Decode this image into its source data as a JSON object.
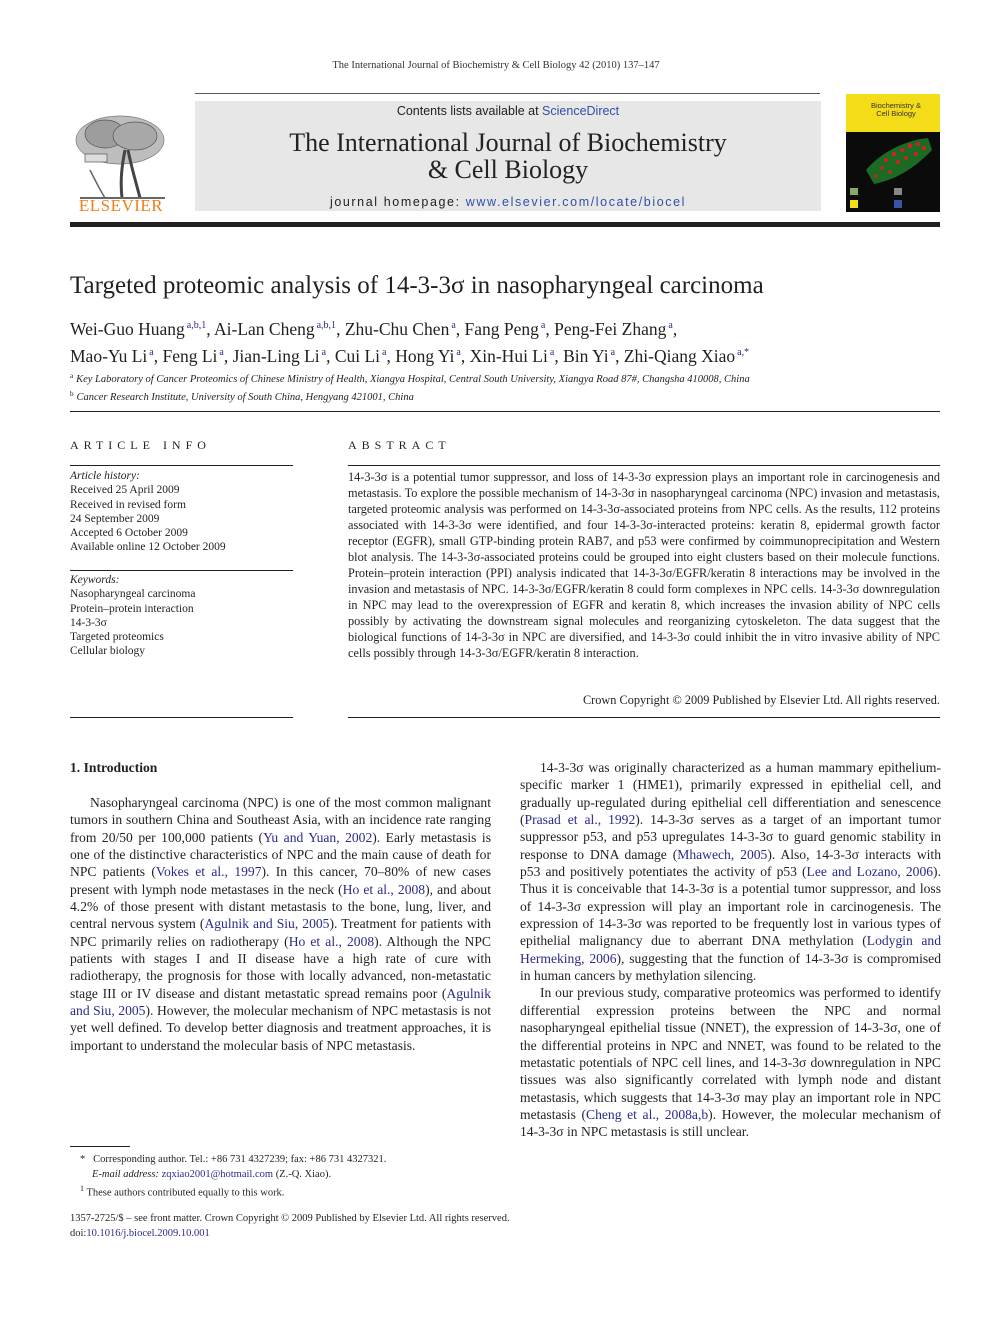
{
  "running_head": "The International Journal of Biochemistry & Cell Biology 42 (2010) 137–147",
  "publisher": {
    "name": "ELSEVIER",
    "logo_icon": "elsevier-tree-icon",
    "brand_color": "#f07e1a"
  },
  "banner": {
    "contents_prefix": "Contents lists available at ",
    "contents_link": "ScienceDirect",
    "journal_title_line1": "The International Journal of Biochemistry",
    "journal_title_line2": "& Cell Biology",
    "homepage_prefix": "journal homepage: ",
    "homepage_url": "www.elsevier.com/locate/biocel",
    "link_color": "#2f51a6"
  },
  "cover": {
    "title_line1": "Biochemistry &",
    "title_line2": "Cell Biology",
    "icon": "journal-cover-thumbnail"
  },
  "article": {
    "title": "Targeted proteomic analysis of 14-3-3σ in nasopharyngeal carcinoma",
    "authors": [
      {
        "name": "Wei-Guo Huang",
        "sup": "a,b,1"
      },
      {
        "name": "Ai-Lan Cheng",
        "sup": "a,b,1"
      },
      {
        "name": "Zhu-Chu Chen",
        "sup": "a"
      },
      {
        "name": "Fang Peng",
        "sup": "a"
      },
      {
        "name": "Peng-Fei Zhang",
        "sup": "a"
      },
      {
        "name": "Mao-Yu Li",
        "sup": "a"
      },
      {
        "name": "Feng Li",
        "sup": "a"
      },
      {
        "name": "Jian-Ling Li",
        "sup": "a"
      },
      {
        "name": "Cui Li",
        "sup": "a"
      },
      {
        "name": "Hong Yi",
        "sup": "a"
      },
      {
        "name": "Xin-Hui Li",
        "sup": "a"
      },
      {
        "name": "Bin Yi",
        "sup": "a"
      },
      {
        "name": "Zhi-Qiang Xiao",
        "sup": "a,*"
      }
    ],
    "affiliations": [
      {
        "mark": "a",
        "text": "Key Laboratory of Cancer Proteomics of Chinese Ministry of Health, Xiangya Hospital, Central South University, Xiangya Road 87#, Changsha 410008, China"
      },
      {
        "mark": "b",
        "text": "Cancer Research Institute, University of South China, Hengyang 421001, China"
      }
    ]
  },
  "article_info": {
    "heading": "ARTICLE INFO",
    "history_label": "Article history:",
    "history": [
      "Received 25 April 2009",
      "Received in revised form",
      "24 September 2009",
      "Accepted 6 October 2009",
      "Available online 12 October 2009"
    ],
    "keywords_label": "Keywords:",
    "keywords": [
      "Nasopharyngeal carcinoma",
      "Protein–protein interaction",
      "14-3-3σ",
      "Targeted proteomics",
      "Cellular biology"
    ]
  },
  "abstract": {
    "heading": "ABSTRACT",
    "text": "14-3-3σ is a potential tumor suppressor, and loss of 14-3-3σ expression plays an important role in carcinogenesis and metastasis. To explore the possible mechanism of 14-3-3σ in nasopharyngeal carcinoma (NPC) invasion and metastasis, targeted proteomic analysis was performed on 14-3-3σ-associated proteins from NPC cells. As the results, 112 proteins associated with 14-3-3σ were identified, and four 14-3-3σ-interacted proteins: keratin 8, epidermal growth factor receptor (EGFR), small GTP-binding protein RAB7, and p53 were confirmed by coimmunoprecipitation and Western blot analysis. The 14-3-3σ-associated proteins could be grouped into eight clusters based on their molecule functions. Protein–protein interaction (PPI) analysis indicated that 14-3-3σ/EGFR/keratin 8 interactions may be involved in the invasion and metastasis of NPC. 14-3-3σ/EGFR/keratin 8 could form complexes in NPC cells. 14-3-3σ downregulation in NPC may lead to the overexpression of EGFR and keratin 8, which increases the invasion ability of NPC cells possibly by activating the downstream signal molecules and reorganizing cytoskeleton. The data suggest that the biological functions of 14-3-3σ in NPC are diversified, and 14-3-3σ could inhibit the in vitro invasive ability of NPC cells possibly through 14-3-3σ/EGFR/keratin 8 interaction.",
    "copyright": "Crown Copyright © 2009 Published by Elsevier Ltd. All rights reserved."
  },
  "body": {
    "section_heading": "1.  Introduction",
    "left_paragraphs": [
      [
        {
          "t": "Nasopharyngeal carcinoma (NPC) is one of the most common malignant tumors in southern China and Southeast Asia, with an incidence rate ranging from 20/50 per 100,000 patients ("
        },
        {
          "l": "Yu and Yuan, 2002"
        },
        {
          "t": "). Early metastasis is one of the distinctive characteristics of NPC and the main cause of death for NPC patients ("
        },
        {
          "l": "Vokes et al., 1997"
        },
        {
          "t": "). In this cancer, 70–80% of new cases present with lymph node metastases in the neck ("
        },
        {
          "l": "Ho et al., 2008"
        },
        {
          "t": "), and about 4.2% of those present with distant metastasis to the bone, lung, liver, and central nervous system ("
        },
        {
          "l": "Agulnik and Siu, 2005"
        },
        {
          "t": "). Treatment for patients with NPC primarily relies on radiotherapy ("
        },
        {
          "l": "Ho et al., 2008"
        },
        {
          "t": "). Although the NPC patients with stages I and II disease have a high rate of cure with radiotherapy, the prognosis for those with locally advanced, non-metastatic stage III or IV disease and distant metastatic spread remains poor ("
        },
        {
          "l": "Agulnik and Siu, 2005"
        },
        {
          "t": "). However, the molecular mechanism of NPC metastasis is not yet well defined. To develop better diagnosis and treatment approaches, it is important to understand the molecular basis of NPC metastasis."
        }
      ]
    ],
    "right_paragraphs": [
      [
        {
          "t": "14-3-3σ was originally characterized as a human mammary epithelium-specific marker 1 (HME1), primarily expressed in epithelial cell, and gradually up-regulated during epithelial cell differentiation and senescence ("
        },
        {
          "l": "Prasad et al., 1992"
        },
        {
          "t": "). 14-3-3σ serves as a target of an important tumor suppressor p53, and p53 upregulates 14-3-3σ to guard genomic stability in response to DNA damage ("
        },
        {
          "l": "Mhawech, 2005"
        },
        {
          "t": "). Also, 14-3-3σ interacts with p53 and positively potentiates the activity of p53 ("
        },
        {
          "l": "Lee and Lozano, 2006"
        },
        {
          "t": "). Thus it is conceivable that 14-3-3σ is a potential tumor suppressor, and loss of 14-3-3σ expression will play an important role in carcinogenesis. The expression of 14-3-3σ was reported to be frequently lost in various types of epithelial malignancy due to aberrant DNA methylation ("
        },
        {
          "l": "Lodygin and Hermeking, 2006"
        },
        {
          "t": "), suggesting that the function of 14-3-3σ is compromised in human cancers by methylation silencing."
        }
      ],
      [
        {
          "t": "In our previous study, comparative proteomics was performed to identify differential expression proteins between the NPC and normal nasopharyngeal epithelial tissue (NNET), the expression of 14-3-3σ, one of the differential proteins in NPC and NNET, was found to be related to the metastatic potentials of NPC cell lines, and 14-3-3σ downregulation in NPC tissues was also significantly correlated with lymph node and distant metastasis, which suggests that 14-3-3σ may play an important role in NPC metastasis ("
        },
        {
          "l": "Cheng et al., 2008a,b"
        },
        {
          "t": "). However, the molecular mechanism of 14-3-3σ in NPC metastasis is still unclear."
        }
      ]
    ]
  },
  "footnotes": {
    "corresponding_mark": "*",
    "corresponding": "Corresponding author. Tel.: +86 731 4327239; fax: +86 731 4327321.",
    "email_label": "E-mail address:",
    "email": "zqxiao2001@hotmail.com",
    "email_suffix": " (Z.-Q. Xiao).",
    "equal_mark": "1",
    "equal": "These authors contributed equally to this work."
  },
  "front_matter": {
    "issn_line": "1357-2725/$ – see front matter. Crown Copyright © 2009 Published by Elsevier Ltd. All rights reserved.",
    "doi_prefix": "doi:",
    "doi": "10.1016/j.biocel.2009.10.001"
  }
}
